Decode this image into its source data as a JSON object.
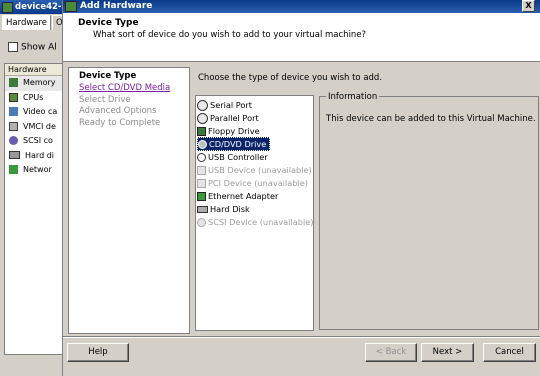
{
  "background_window": {
    "title": "device42-",
    "tabs": [
      "Hardware",
      "Op"
    ],
    "show_all_label": "Show Al",
    "list_header": "Hardware",
    "items": [
      {
        "label": "Memory",
        "icon": "memory-icon"
      },
      {
        "label": "CPUs",
        "icon": "cpu-icon"
      },
      {
        "label": "Video ca",
        "icon": "video-card-icon"
      },
      {
        "label": "VMCI de",
        "icon": "vmci-icon"
      },
      {
        "label": "SCSI co",
        "icon": "scsi-controller-icon"
      },
      {
        "label": "Hard di",
        "icon": "hard-disk-icon"
      },
      {
        "label": "Networ",
        "icon": "network-adapter-icon"
      }
    ]
  },
  "dialog": {
    "title": "Add Hardware",
    "close_label": "X",
    "header": {
      "title": "Device Type",
      "subtitle": "What sort of device do you wish to add to your virtual machine?"
    },
    "steps": [
      {
        "label": "Device Type",
        "state": "current"
      },
      {
        "label": "Select CD/DVD Media",
        "state": "link"
      },
      {
        "label": "Select Drive",
        "state": "pending"
      },
      {
        "label": "Advanced Options",
        "state": "pending"
      },
      {
        "label": "Ready to Complete",
        "state": "pending"
      }
    ],
    "instruction": "Choose the type of device you wish to add.",
    "devices": [
      {
        "label": "Serial Port",
        "icon": "serial-port-icon",
        "enabled": true
      },
      {
        "label": "Parallel Port",
        "icon": "parallel-port-icon",
        "enabled": true
      },
      {
        "label": "Floppy Drive",
        "icon": "floppy-drive-icon",
        "enabled": true
      },
      {
        "label": "CD/DVD Drive",
        "icon": "cd-dvd-drive-icon",
        "enabled": true,
        "selected": true
      },
      {
        "label": "USB Controller",
        "icon": "usb-controller-icon",
        "enabled": true
      },
      {
        "label": "USB Device (unavailable)",
        "icon": "usb-device-icon",
        "enabled": false
      },
      {
        "label": "PCI Device (unavailable)",
        "icon": "pci-device-icon",
        "enabled": false
      },
      {
        "label": "Ethernet Adapter",
        "icon": "ethernet-adapter-icon",
        "enabled": true
      },
      {
        "label": "Hard Disk",
        "icon": "hard-disk-icon",
        "enabled": true
      },
      {
        "label": "SCSI Device (unavailable)",
        "icon": "scsi-device-icon",
        "enabled": false
      }
    ],
    "information": {
      "legend": "Information",
      "text": "This device can be added to this Virtual Machine."
    },
    "buttons": {
      "help": "Help",
      "back": "< Back",
      "next": "Next >",
      "cancel": "Cancel"
    }
  },
  "colors": {
    "title_bar": "#0a3a8a",
    "selection": "#0a246a",
    "link": "#7a1fa2",
    "disabled_text": "#9c9c9c",
    "window_bg": "#d4d0c8"
  }
}
